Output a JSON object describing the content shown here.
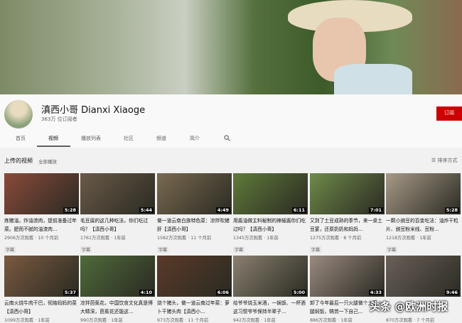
{
  "channel": {
    "name": "滇西小哥 Dianxi Xiaoge",
    "subscribers": "363万 位订阅者",
    "subscribe_label": "订阅"
  },
  "tabs": [
    "首页",
    "视频",
    "播放列表",
    "社区",
    "频道",
    "简介"
  ],
  "active_tab": "视频",
  "section": {
    "title": "上传的视频",
    "play_all": "全部播放",
    "sort_label": "排序方式"
  },
  "watermark": "头条 @欧洲时报",
  "videos": [
    {
      "title": "炼猪油，炸油渣肉，提前准备过年菜。肥而不腻的油渣肉...",
      "views": "2906万次观看 · 10 个月前",
      "duration": "5:28",
      "badge": "字幕",
      "color": "#8a4a3a"
    },
    {
      "title": "毛豆腐的这几种吃法，你们吃过吗？【滇西小哥】",
      "views": "1761万次观看 · 1年前",
      "duration": "5:44",
      "badge": "字幕",
      "color": "#6a5a48"
    },
    {
      "title": "做一道云南白族特色菜：凉拌吹猪肝【滇西小哥】",
      "views": "1582万次观看 · 11 个月前",
      "duration": "4:49",
      "badge": "字幕",
      "color": "#7a6a50"
    },
    {
      "title": "用酱油做主料秘制的辣椒酱你们吃过吗？【滇西小哥】",
      "views": "1345万次观看 · 1年前",
      "duration": "6:11",
      "badge": "字幕",
      "color": "#5f7a3a"
    },
    {
      "title": "又到了土豆成熟的季节，来一桌土豆宴，还原奶奶和妈妈...",
      "views": "1275万次观看 · 8 个月前",
      "duration": "7:01",
      "badge": "字幕",
      "color": "#6f8a4a"
    },
    {
      "title": "一颗小豌豆的百变吃法：油炸干粒片、豌豆粉米线、豆粉...",
      "views": "1218万次观看 · 1年前",
      "duration": "5:28",
      "badge": "字幕",
      "color": "#a89a88"
    },
    {
      "title": "云南火烧牛肉干巴，彻烙妈妈的菜【滇西小哥】",
      "views": "1099万次观看 · 1年前",
      "duration": "5:37",
      "badge": "",
      "color": "#7a5a40"
    },
    {
      "title": "凉拌芭蕉花，中国饮食文化真是博大精深，芭蕉花还能这...",
      "views": "990万次观看 · 1年前",
      "duration": "4:10",
      "badge": "",
      "color": "#4f6a3a"
    },
    {
      "title": "烧个猪头，做一道云南过年菜：萝卜干猪头肉【滇西小...",
      "views": "973万次观看 · 11 个月前",
      "duration": "6:06",
      "badge": "",
      "color": "#5a3a28"
    },
    {
      "title": "给爷爷烧玉米酒，一锅饭、一杯酒这习惯爷爷保持半辈子...",
      "views": "942万次观看 · 1年前",
      "duration": "5:00",
      "badge": "",
      "color": "#8a8070"
    },
    {
      "title": "卸了今年最后一只火腿做个土豆火腿焖饭，犒劳一下自己...",
      "views": "886万次观看 · 1年前",
      "duration": "4:33",
      "badge": "",
      "color": "#9a8a80"
    },
    {
      "title": "",
      "views": "870万次观看 · 7 个月前",
      "duration": "9:46",
      "badge": "",
      "color": "#6a6058"
    }
  ]
}
